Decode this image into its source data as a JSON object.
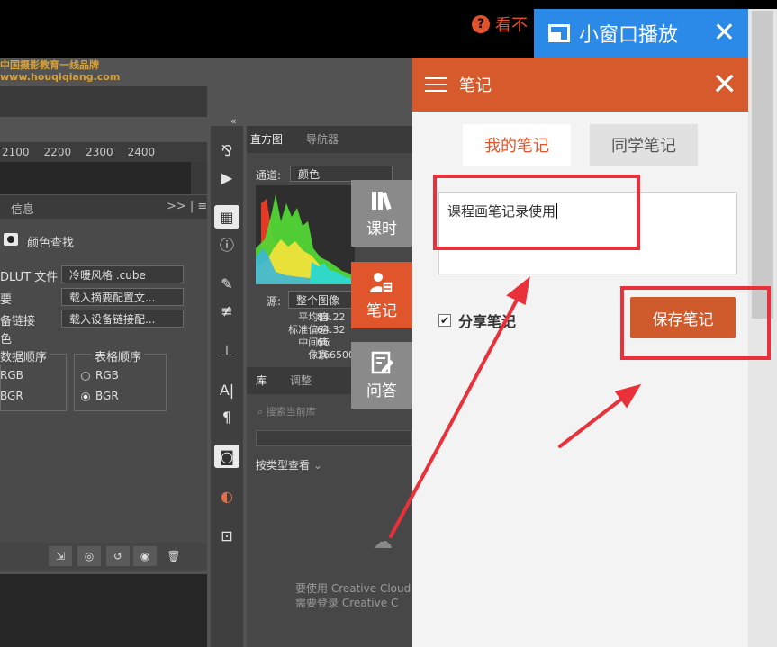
{
  "colors": {
    "accent": "#d65a2c",
    "pip_blue": "#2b8ae8",
    "annotation_red": "#e8313a"
  },
  "top": {
    "help_text": "看不"
  },
  "pip": {
    "label": "小窗口播放",
    "close": "✕"
  },
  "brand": {
    "line1": "中国摄影教育一线品牌",
    "line2": "www.houqiqiang.com"
  },
  "ps": {
    "ruler": [
      "2100",
      "2200",
      "2300",
      "2400"
    ],
    "tabs": {
      "info": "信息",
      "more": ">> | ≡"
    },
    "lookup_label": "颜色查找",
    "rows": [
      {
        "label": "DLUT 文件",
        "value": "冷暖风格 .cube"
      },
      {
        "label": "要",
        "value": "载入摘要配置文..."
      },
      {
        "label": "备链接",
        "value": "载入设备链接配..."
      },
      {
        "label": "色",
        "value": ""
      }
    ],
    "data_order": {
      "title": "数据顺序",
      "opt1": "RGB",
      "opt2": "BGR"
    },
    "table_order": {
      "title": "表格顺序",
      "opt1": "RGB",
      "opt2": "BGR"
    },
    "right": {
      "tab_hist": "直方图",
      "tab_nav": "导航器",
      "channel_label": "通道:",
      "channel_value": "颜色",
      "source_label": "源:",
      "source_value": "整个图像",
      "stats": [
        {
          "k": "平均值:",
          "v": "84.22"
        },
        {
          "k": "标准偏差:",
          "v": "64.32"
        },
        {
          "k": "中间值:",
          "v": "66"
        },
        {
          "k": "像素:",
          "v": "166500"
        }
      ],
      "lib_tab": "库",
      "adj_tab": "调整",
      "search_placeholder": "搜索当前库",
      "view_by": "按类型查看",
      "cc_line1": "要使用 Creative Cloud",
      "cc_line2": "需要登录 Creative C"
    }
  },
  "side_tabs": [
    {
      "label": "课时"
    },
    {
      "label": "笔记"
    },
    {
      "label": "问答"
    }
  ],
  "notes": {
    "title": "笔记",
    "close": "✕",
    "tab_mine": "我的笔记",
    "tab_class": "同学笔记",
    "content": "课程画笔记录使用",
    "share_label": "分享笔记",
    "share_checked": true,
    "save_label": "保存笔记"
  }
}
